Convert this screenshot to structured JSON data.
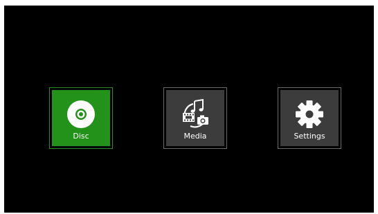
{
  "menu": {
    "items": [
      {
        "label": "Disc",
        "icon": "disc-icon",
        "selected": true
      },
      {
        "label": "Media",
        "icon": "media-icon",
        "selected": false
      },
      {
        "label": "Settings",
        "icon": "gear-icon",
        "selected": false
      }
    ]
  },
  "colors": {
    "background": "#000000",
    "selected_tile": "#23921a",
    "tile": "#3c3c3c",
    "text": "#ffffff"
  }
}
